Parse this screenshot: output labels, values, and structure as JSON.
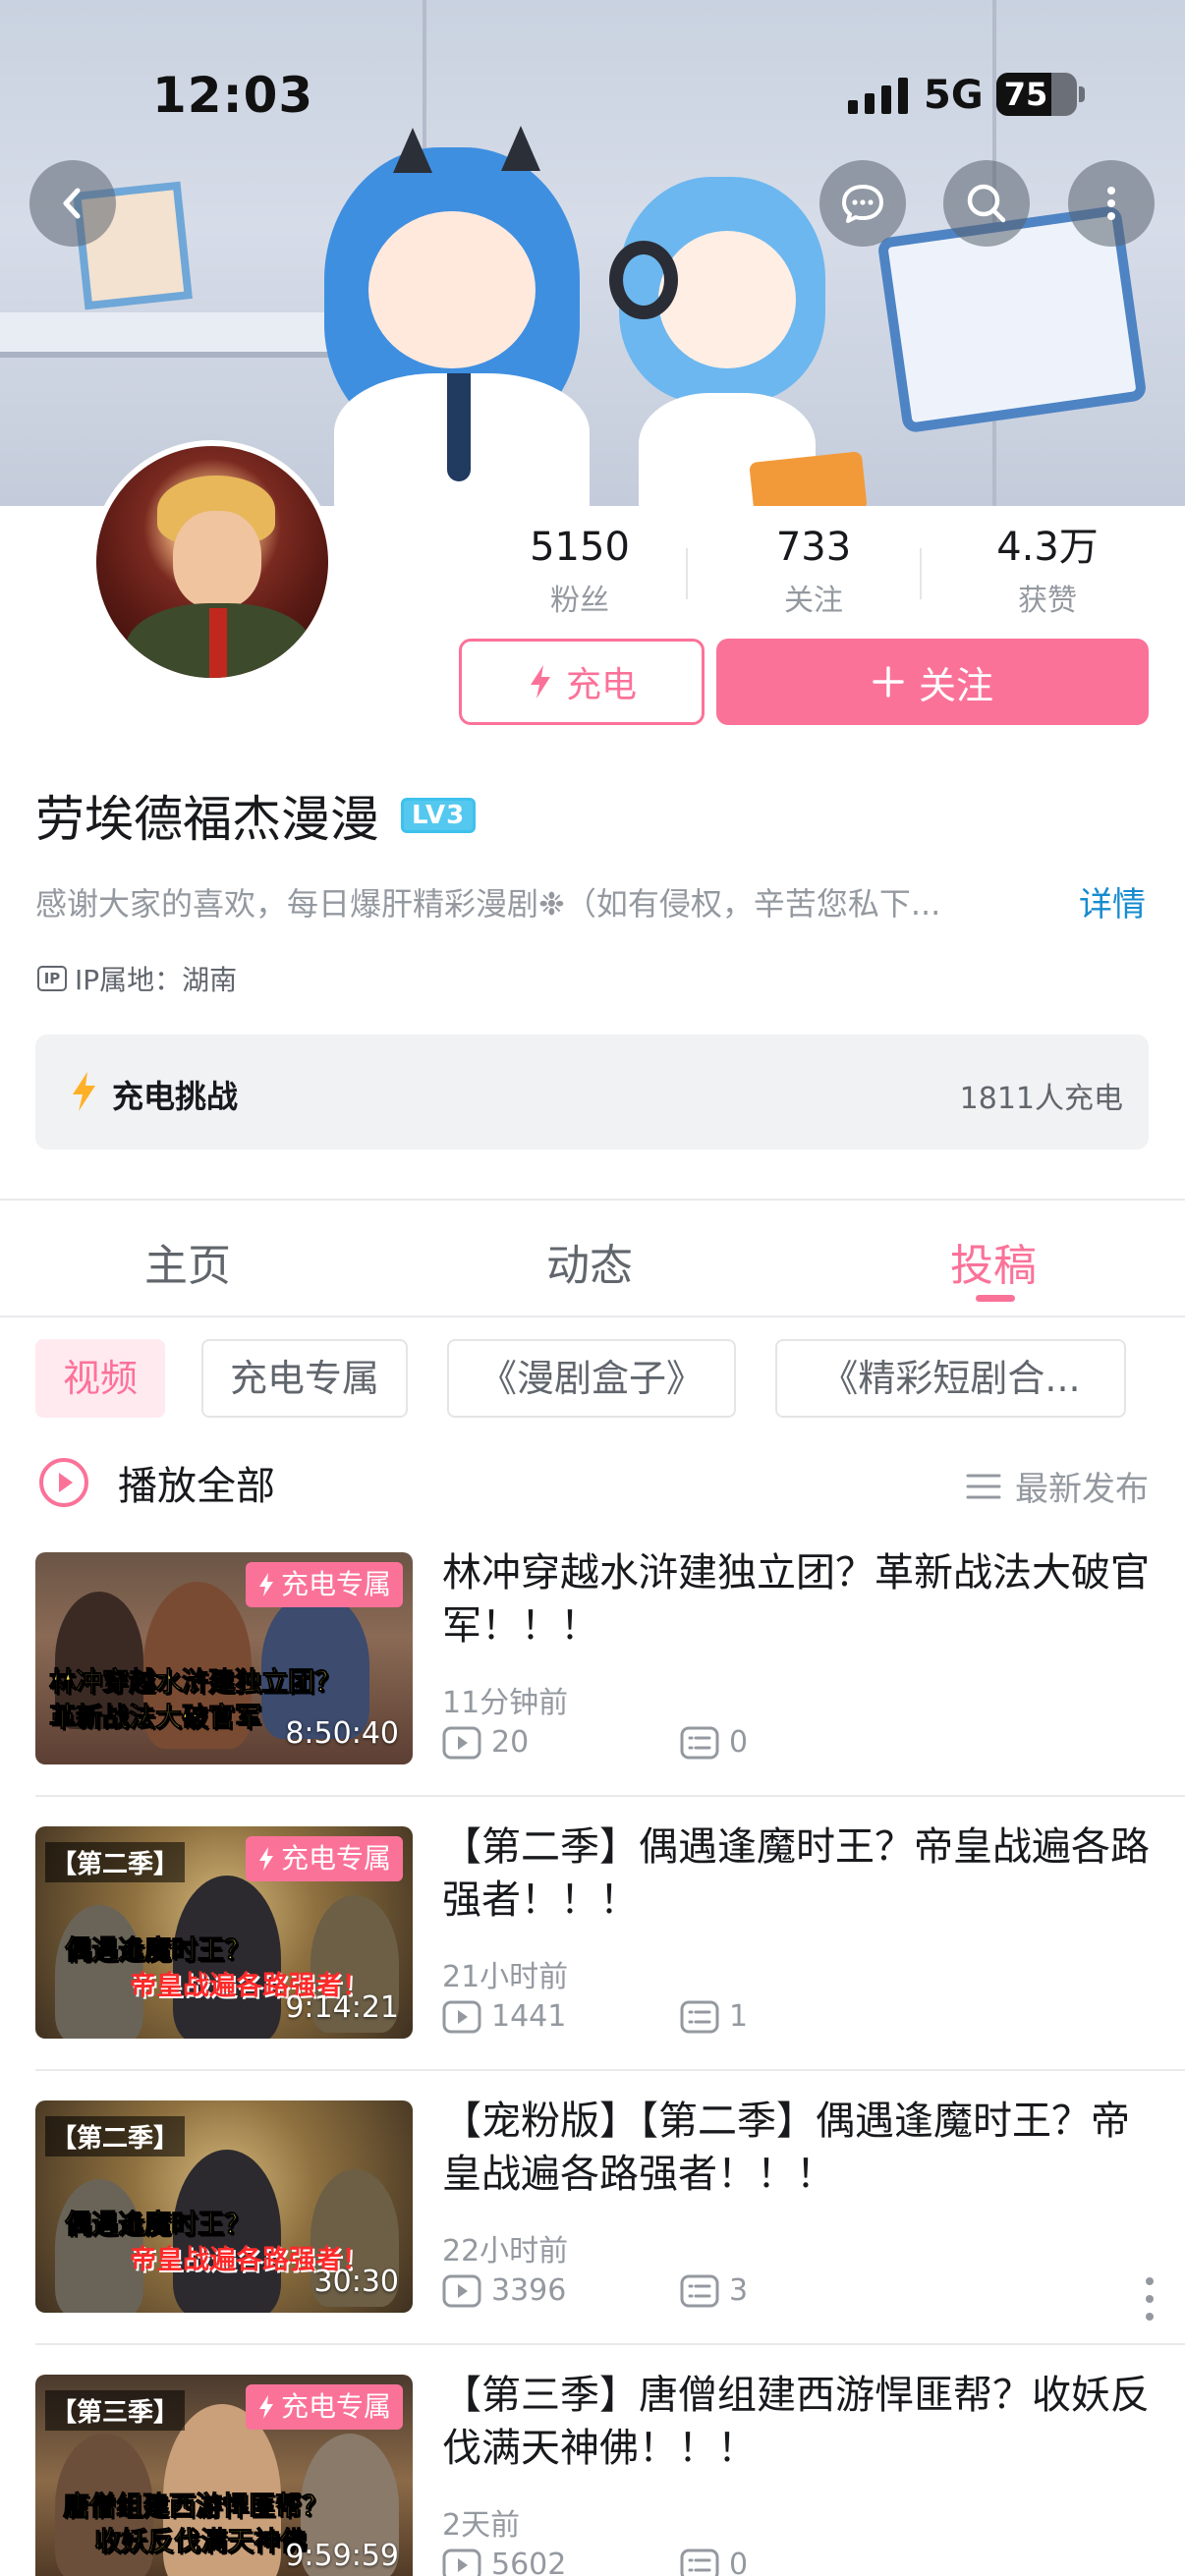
{
  "status_bar": {
    "time": "12:03",
    "network": "5G",
    "battery": "75"
  },
  "header": {
    "back_icon": "chevron-left-icon",
    "message_icon": "chat-bubble-icon",
    "search_icon": "search-icon",
    "more_icon": "more-vertical-icon"
  },
  "profile": {
    "stats": [
      {
        "value": "5150",
        "label": "粉丝"
      },
      {
        "value": "733",
        "label": "关注"
      },
      {
        "value": "4.3万",
        "label": "获赞"
      }
    ],
    "charge_button": "充电",
    "follow_button": "关注",
    "name": "劳埃德福杰漫漫",
    "level": "LV3",
    "bio": "感谢大家的喜欢，每日爆肝精彩漫剧❉（如有侵权，辛苦您私下...",
    "detail_link": "详情",
    "ip_label": "IP属地：湖南"
  },
  "charge_challenge": {
    "title": "充电挑战",
    "count": "1811人充电"
  },
  "tabs": [
    {
      "label": "主页",
      "active": false
    },
    {
      "label": "动态",
      "active": false
    },
    {
      "label": "投稿",
      "active": true
    }
  ],
  "filters": [
    {
      "label": "视频",
      "active": true
    },
    {
      "label": "充电专属",
      "active": false
    },
    {
      "label": "《漫剧盒子》",
      "active": false
    },
    {
      "label": "《精彩短剧合...",
      "active": false
    }
  ],
  "play_all": "播放全部",
  "sort_label": "最新发布",
  "accent_color": "#fb7299",
  "videos": [
    {
      "title": "林冲穿越水浒建独立团？革新战法大破官军！！！",
      "time": "11分钟前",
      "plays": "20",
      "comments": "0",
      "duration": "8:50:40",
      "badge": "充电专属",
      "season": "",
      "cover_lines": [
        "林冲穿越水浒建独立团？",
        "革新战法大破官军"
      ]
    },
    {
      "title": "【第二季】偶遇逢魔时王？帝皇战遍各路强者！！！",
      "time": "21小时前",
      "plays": "1441",
      "comments": "1",
      "duration": "9:14:21",
      "badge": "充电专属",
      "season": "【第二季】",
      "cover_lines": [
        "偶遇逢魔时王？",
        "帝皇战遍各路强者！"
      ]
    },
    {
      "title": "【宠粉版】【第二季】偶遇逢魔时王？帝皇战遍各路强者！！！",
      "time": "22小时前",
      "plays": "3396",
      "comments": "3",
      "duration": "30:30",
      "badge": "",
      "season": "【第二季】",
      "cover_lines": [
        "偶遇逢魔时王？",
        "帝皇战遍各路强者！"
      ]
    },
    {
      "title": "【第三季】唐僧组建西游悍匪帮？收妖反伐满天神佛！！！",
      "time": "2天前",
      "plays": "5602",
      "comments": "0",
      "duration": "9:59:59",
      "badge": "充电专属",
      "season": "【第三季】",
      "cover_lines": [
        "唐僧组建西游悍匪帮？",
        "收妖反伐满天神佛"
      ]
    }
  ]
}
